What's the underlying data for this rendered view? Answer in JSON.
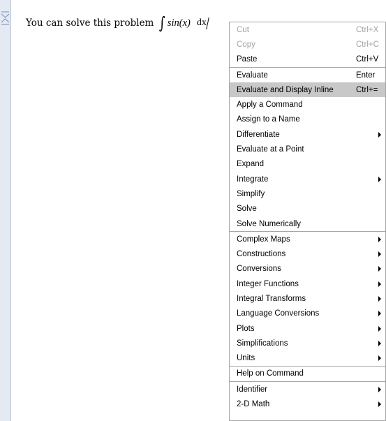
{
  "document": {
    "text": "You can solve this problem",
    "math": {
      "integral_symbol": "∫",
      "expression": "sin(x)",
      "differential": "dx"
    }
  },
  "context_menu": {
    "items": [
      {
        "label": "Cut",
        "shortcut": "Ctrl+X",
        "disabled": true
      },
      {
        "label": "Copy",
        "shortcut": "Ctrl+C",
        "disabled": true
      },
      {
        "label": "Paste",
        "shortcut": "Ctrl+V"
      },
      {
        "separator": true
      },
      {
        "label": "Evaluate",
        "shortcut": "Enter"
      },
      {
        "label": "Evaluate and Display Inline",
        "shortcut": "Ctrl+=",
        "highlighted": true
      },
      {
        "label": "Apply a Command"
      },
      {
        "label": "Assign to a Name"
      },
      {
        "label": "Differentiate",
        "submenu": true
      },
      {
        "label": "Evaluate at a Point"
      },
      {
        "label": "Expand"
      },
      {
        "label": "Integrate",
        "submenu": true
      },
      {
        "label": "Simplify"
      },
      {
        "label": "Solve"
      },
      {
        "label": "Solve Numerically"
      },
      {
        "separator": true
      },
      {
        "label": "Complex Maps",
        "submenu": true
      },
      {
        "label": "Constructions",
        "submenu": true
      },
      {
        "label": "Conversions",
        "submenu": true
      },
      {
        "label": "Integer Functions",
        "submenu": true
      },
      {
        "label": "Integral Transforms",
        "submenu": true
      },
      {
        "label": "Language Conversions",
        "submenu": true
      },
      {
        "label": "Plots",
        "submenu": true
      },
      {
        "label": "Simplifications",
        "submenu": true
      },
      {
        "label": "Units",
        "submenu": true
      },
      {
        "separator": true
      },
      {
        "label": "Help on Command"
      },
      {
        "separator": true
      },
      {
        "label": "Identifier",
        "submenu": true
      },
      {
        "label": "2-D Math",
        "submenu": true
      }
    ]
  },
  "colors": {
    "gutter": "#e4e9f2",
    "highlight": "#c8c8c8",
    "disabled_text": "#a4a4a4",
    "gutter_icon": "#6f8fb7"
  }
}
